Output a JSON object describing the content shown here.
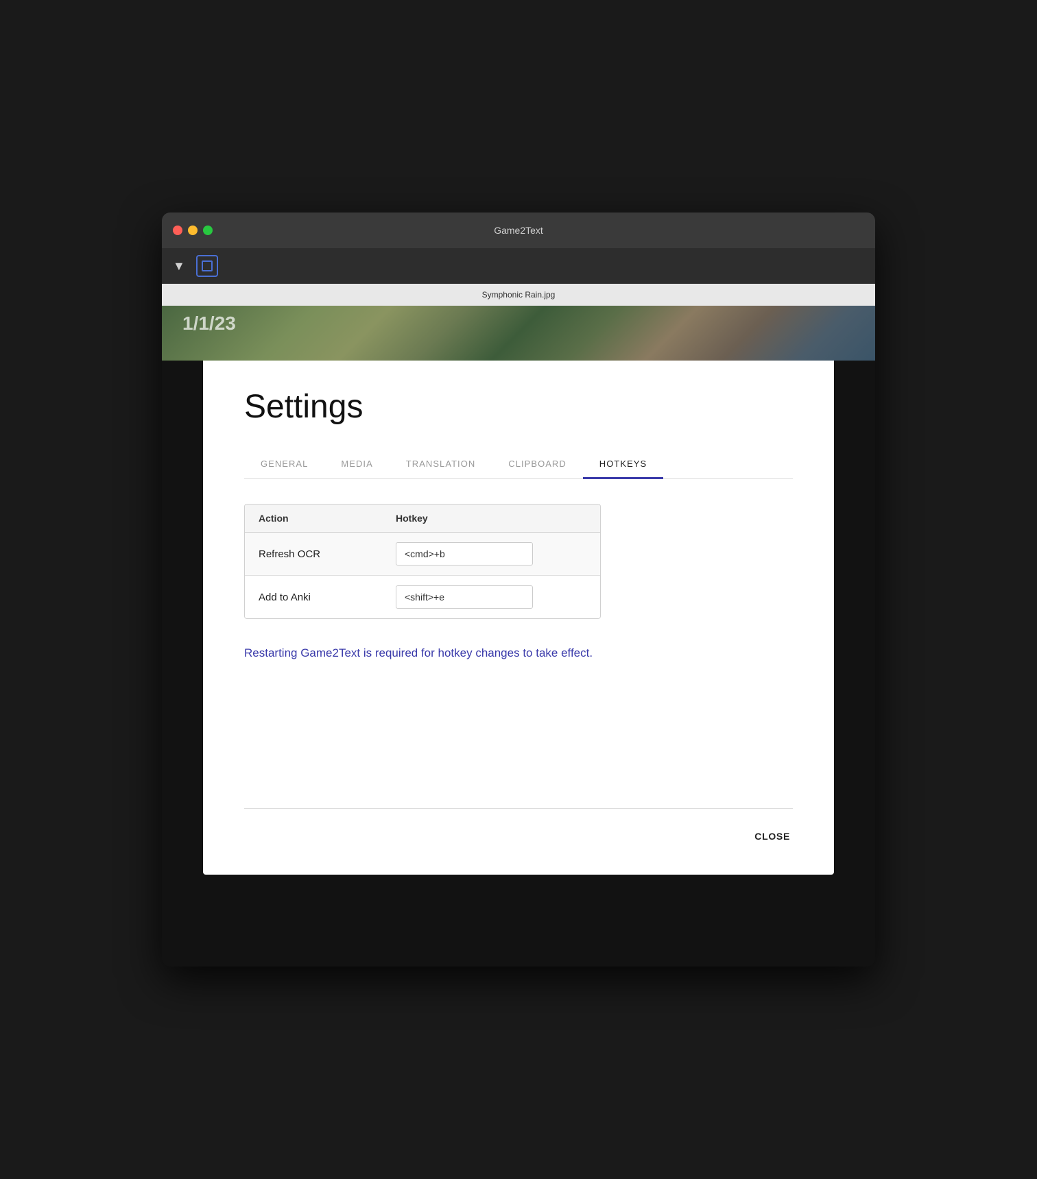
{
  "window": {
    "title": "Game2Text",
    "traffic_lights": {
      "close_label": "close",
      "minimize_label": "minimize",
      "maximize_label": "maximize"
    }
  },
  "toolbar": {
    "chevron_label": "▼",
    "capture_label": "capture"
  },
  "preview": {
    "filename": "Symphonic Rain.jpg"
  },
  "dialog": {
    "title": "Settings",
    "tabs": [
      {
        "label": "GENERAL",
        "active": false
      },
      {
        "label": "MEDIA",
        "active": false
      },
      {
        "label": "TRANSLATION",
        "active": false
      },
      {
        "label": "CLIPBOARD",
        "active": false
      },
      {
        "label": "HOTKEYS",
        "active": true
      }
    ],
    "table": {
      "headers": [
        "Action",
        "Hotkey"
      ],
      "rows": [
        {
          "action": "Refresh OCR",
          "hotkey": "<cmd>+b"
        },
        {
          "action": "Add to Anki",
          "hotkey": "<shift>+e"
        }
      ]
    },
    "restart_notice": "Restarting Game2Text is required for hotkey changes to take effect.",
    "close_button": "CLOSE"
  }
}
